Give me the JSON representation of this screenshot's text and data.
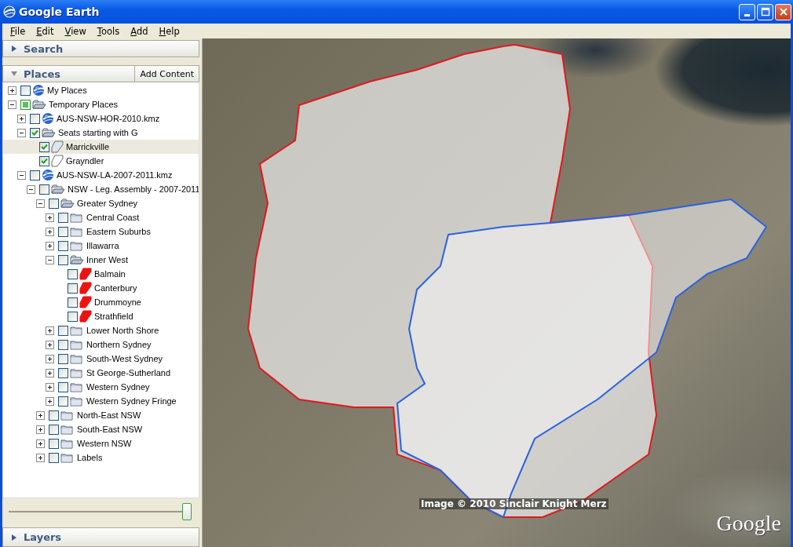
{
  "window": {
    "title": "Google Earth"
  },
  "menu": [
    "File",
    "Edit",
    "View",
    "Tools",
    "Add",
    "Help"
  ],
  "search_panel": {
    "title": "Search",
    "expanded": false
  },
  "places_panel": {
    "title": "Places",
    "expanded": true,
    "button": "Add Content",
    "tree": [
      {
        "label": "My Places",
        "kind": "globe",
        "checked": false,
        "partial": false,
        "expanded": false,
        "selected": false
      },
      {
        "label": "Temporary Places",
        "kind": "folder",
        "checked": false,
        "partial": true,
        "expanded": true,
        "selected": false,
        "children": [
          {
            "label": "AUS-NSW-HOR-2010.kmz",
            "kind": "globe",
            "checked": false,
            "partial": false,
            "expanded": false,
            "selected": false
          },
          {
            "label": "Seats starting with G",
            "kind": "folder",
            "checked": true,
            "partial": false,
            "expanded": true,
            "selected": false,
            "children": [
              {
                "label": "Marrickville",
                "kind": "shape",
                "color": "#dce6f2",
                "checked": true,
                "partial": false,
                "selected": true
              },
              {
                "label": "Grayndler",
                "kind": "shape",
                "color": "#ffffff",
                "checked": true,
                "partial": false,
                "selected": false
              }
            ]
          },
          {
            "label": "AUS-NSW-LA-2007-2011.kmz",
            "kind": "globe",
            "checked": false,
            "partial": false,
            "expanded": true,
            "selected": false,
            "children": [
              {
                "label": "NSW - Leg. Assembly - 2007-2011",
                "kind": "folder",
                "checked": false,
                "partial": false,
                "expanded": true,
                "selected": false,
                "children": [
                  {
                    "label": "Greater Sydney",
                    "kind": "folder",
                    "checked": false,
                    "partial": false,
                    "expanded": true,
                    "selected": false,
                    "children": [
                      {
                        "label": "Central Coast",
                        "kind": "folder",
                        "checked": false,
                        "partial": false,
                        "expanded": false,
                        "selected": false
                      },
                      {
                        "label": "Eastern Suburbs",
                        "kind": "folder",
                        "checked": false,
                        "partial": false,
                        "expanded": false,
                        "selected": false
                      },
                      {
                        "label": "Illawarra",
                        "kind": "folder",
                        "checked": false,
                        "partial": false,
                        "expanded": false,
                        "selected": false
                      },
                      {
                        "label": "Inner West",
                        "kind": "folder",
                        "checked": false,
                        "partial": false,
                        "expanded": true,
                        "selected": false,
                        "children": [
                          {
                            "label": "Balmain",
                            "kind": "shape",
                            "color": "#ee1111",
                            "checked": false,
                            "partial": false,
                            "selected": false
                          },
                          {
                            "label": "Canterbury",
                            "kind": "shape",
                            "color": "#ee1111",
                            "checked": false,
                            "partial": false,
                            "selected": false
                          },
                          {
                            "label": "Drummoyne",
                            "kind": "shape",
                            "color": "#ee1111",
                            "checked": false,
                            "partial": false,
                            "selected": false
                          },
                          {
                            "label": "Strathfield",
                            "kind": "shape",
                            "color": "#ee1111",
                            "checked": false,
                            "partial": false,
                            "selected": false
                          }
                        ]
                      },
                      {
                        "label": "Lower North Shore",
                        "kind": "folder",
                        "checked": false,
                        "partial": false,
                        "expanded": false,
                        "selected": false
                      },
                      {
                        "label": "Northern Sydney",
                        "kind": "folder",
                        "checked": false,
                        "partial": false,
                        "expanded": false,
                        "selected": false
                      },
                      {
                        "label": "South-West Sydney",
                        "kind": "folder",
                        "checked": false,
                        "partial": false,
                        "expanded": false,
                        "selected": false
                      },
                      {
                        "label": "St George-Sutherland",
                        "kind": "folder",
                        "checked": false,
                        "partial": false,
                        "expanded": false,
                        "selected": false
                      },
                      {
                        "label": "Western Sydney",
                        "kind": "folder",
                        "checked": false,
                        "partial": false,
                        "expanded": false,
                        "selected": false
                      },
                      {
                        "label": "Western Sydney Fringe",
                        "kind": "folder",
                        "checked": false,
                        "partial": false,
                        "expanded": false,
                        "selected": false
                      }
                    ]
                  },
                  {
                    "label": "North-East NSW",
                    "kind": "folder",
                    "checked": false,
                    "partial": false,
                    "expanded": false,
                    "selected": false
                  },
                  {
                    "label": "South-East NSW",
                    "kind": "folder",
                    "checked": false,
                    "partial": false,
                    "expanded": false,
                    "selected": false
                  },
                  {
                    "label": "Western NSW",
                    "kind": "folder",
                    "checked": false,
                    "partial": false,
                    "expanded": false,
                    "selected": false
                  },
                  {
                    "label": "Labels",
                    "kind": "folder",
                    "checked": false,
                    "partial": false,
                    "expanded": false,
                    "selected": false
                  }
                ]
              }
            ]
          }
        ]
      }
    ]
  },
  "opacity_slider": {
    "level": 1
  },
  "layers_panel": {
    "title": "Layers",
    "expanded": false
  },
  "map": {
    "credit": "Image © 2010 Sinclair Knight Merz",
    "logo": "Google"
  }
}
